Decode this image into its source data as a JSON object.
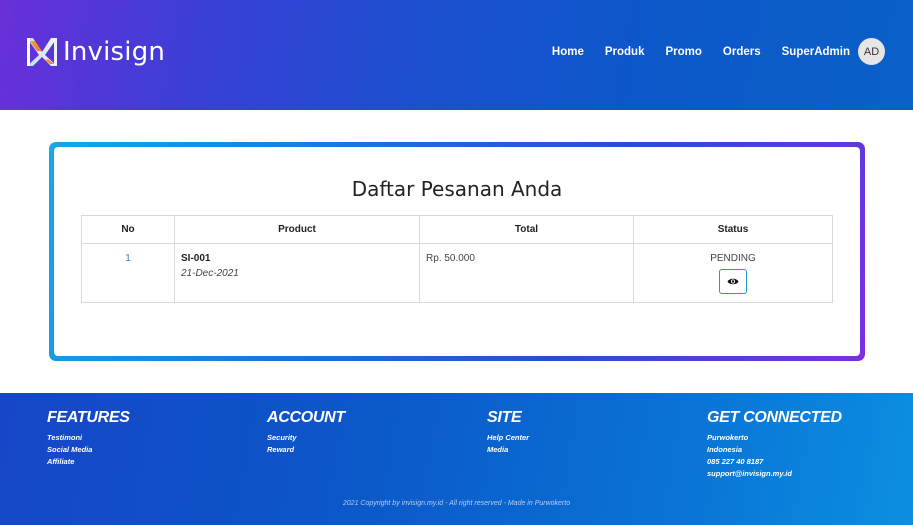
{
  "header": {
    "brand": "Invisign",
    "nav": [
      "Home",
      "Produk",
      "Promo",
      "Orders"
    ],
    "user_name": "SuperAdmin",
    "avatar_initials": "AD"
  },
  "orders": {
    "title": "Daftar Pesanan Anda",
    "columns": [
      "No",
      "Product",
      "Total",
      "Status"
    ],
    "rows": [
      {
        "no": "1",
        "product_code": "SI-001",
        "product_date": "21-Dec-2021",
        "total": "Rp. 50.000",
        "status": "PENDING",
        "action_icon": "eye-icon"
      }
    ]
  },
  "footer": {
    "features": {
      "title": "FEATURES",
      "items": [
        "Testimoni",
        "Social Media",
        "Affiliate"
      ]
    },
    "account": {
      "title": "ACCOUNT",
      "items": [
        "Security",
        "Reward"
      ]
    },
    "site": {
      "title": "SITE",
      "items": [
        "Help Center",
        "Media"
      ]
    },
    "connect": {
      "title": "GET CONNECTED",
      "items": [
        "Purwokerto",
        "Indonesia",
        "085 227 40 8187",
        "support@invisign.my.id"
      ]
    },
    "copyright": "2021 Copyright by invisign.my.id - All right reserved - Made in Purwokerto"
  },
  "colors": {
    "header_start": "#6a2fd8",
    "header_end": "#0a60c8",
    "card_border_start": "#16a8e8",
    "card_border_end": "#7a2fe0",
    "footer": "#0b58c9",
    "action_button": "#17a2b8"
  }
}
